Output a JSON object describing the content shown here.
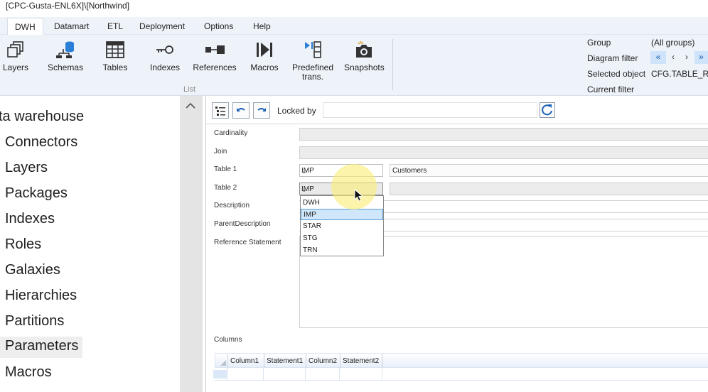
{
  "window": {
    "title": "[CPC-Gusta-ENL6X]\\[Northwind]"
  },
  "menu": [
    "DWH",
    "Datamart",
    "ETL",
    "Deployment",
    "Options",
    "Help"
  ],
  "ribbon": {
    "buttons": [
      "Layers",
      "Schemas",
      "Tables",
      "Indexes",
      "References",
      "Macros",
      "Predefined trans.",
      "Snapshots"
    ],
    "group_label": "List"
  },
  "right_panel": {
    "group_label": "Group",
    "group_value": "(All groups)",
    "diagram_filter_label": "Diagram filter",
    "nav": [
      "«",
      "‹",
      "›",
      "»"
    ],
    "selected_object_label": "Selected object",
    "selected_object_value": "CFG.TABLE_REF",
    "current_filter_label": "Current filter"
  },
  "tree": {
    "items": [
      "ta warehouse",
      "Connectors",
      "Layers",
      "Packages",
      "Indexes",
      "Roles",
      "Galaxies",
      "Hierarchies",
      "Partitions",
      "Parameters",
      "Macros"
    ]
  },
  "toolbar": {
    "locked_by_label": "Locked by",
    "locked_by_value": ""
  },
  "form": {
    "labels": [
      "Cardinality",
      "Join",
      "Table 1",
      "Table 2",
      "Description",
      "ParentDescription",
      "Reference Statement"
    ],
    "table1_layer": "IMP",
    "table1_name": "Customers",
    "table2_layer": "IMP",
    "dropdown_options": [
      "DWH",
      "IMP",
      "STAR",
      "STG",
      "TRN"
    ],
    "dropdown_selected": "IMP",
    "columns_label": "Columns",
    "column_headers": [
      "Column1",
      "Statement1",
      "Column2",
      "Statement2"
    ]
  },
  "colors": {
    "accent": "#1a5fb4",
    "selection": "#cfe6fb",
    "cursor_highlight": "#faee78"
  }
}
